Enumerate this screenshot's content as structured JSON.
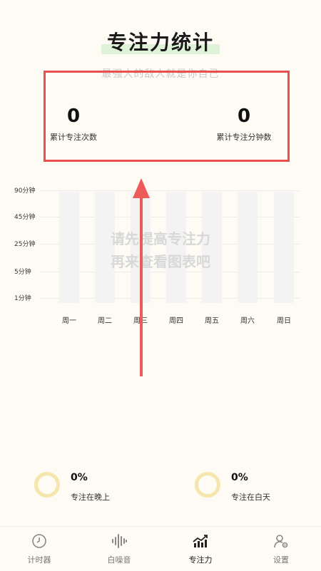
{
  "header": {
    "title": "专注力统计",
    "subtitle": "最强大的敌人就是你自己"
  },
  "stats": {
    "total_sessions": {
      "value": "0",
      "label": "累计专注次数"
    },
    "total_minutes": {
      "value": "0",
      "label": "累计专注分钟数"
    }
  },
  "chart": {
    "y_labels": [
      "90分钟",
      "45分钟",
      "25分钟",
      "5分钟",
      "1分钟"
    ],
    "x_labels": [
      "周一",
      "周二",
      "周三",
      "周四",
      "周五",
      "周六",
      "周日"
    ],
    "empty_message_line1": "请先提高专注力",
    "empty_message_line2": "再来查看图表吧"
  },
  "chart_data": {
    "type": "bar",
    "categories": [
      "周一",
      "周二",
      "周三",
      "周四",
      "周五",
      "周六",
      "周日"
    ],
    "values": [
      0,
      0,
      0,
      0,
      0,
      0,
      0
    ],
    "y_ticks": [
      "1分钟",
      "5分钟",
      "25分钟",
      "45分钟",
      "90分钟"
    ]
  },
  "summary": {
    "night": {
      "percent": "0%",
      "label": "专注在晚上"
    },
    "day": {
      "percent": "0%",
      "label": "专注在白天"
    }
  },
  "colors": {
    "accent_highlight": "#e85050",
    "ring": "#f4e6ad",
    "title_marker": "#dff3d8"
  },
  "tabbar": [
    {
      "label": "计时器",
      "icon": "clock-icon"
    },
    {
      "label": "白噪音",
      "icon": "waveform-icon"
    },
    {
      "label": "专注力",
      "icon": "chart-trend-icon"
    },
    {
      "label": "设置",
      "icon": "settings-user-icon"
    }
  ]
}
